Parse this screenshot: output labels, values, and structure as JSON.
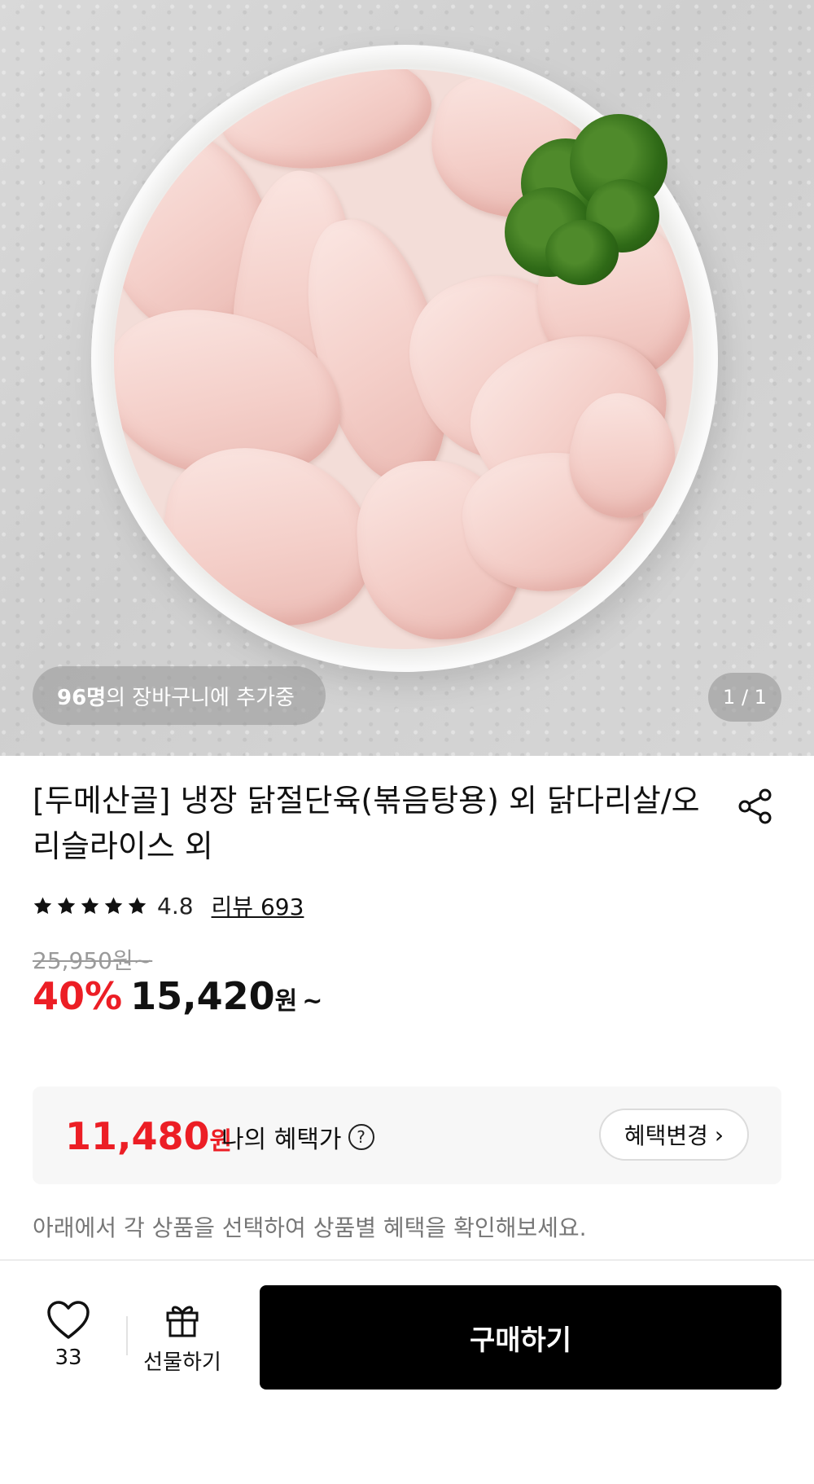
{
  "hero": {
    "basket_count": "96명",
    "basket_suffix": "의 장바구니에 추가중",
    "image_counter": "1 / 1"
  },
  "product": {
    "title": "[두메산골] 냉장 닭절단육(볶음탕용) 외 닭다리살/오리슬라이스 외",
    "share_icon": "share-icon",
    "rating": "4.8",
    "stars": 5,
    "review_label": "리뷰 693",
    "original_price": "25,950원~",
    "discount": "40%",
    "price": "15,420",
    "price_unit": "원",
    "price_tilde": "~"
  },
  "benefit": {
    "price": "11,480",
    "unit": "원",
    "label": "나의 혜택가",
    "help_icon": "?",
    "change_button": "혜택변경",
    "change_chevron": "›"
  },
  "helper_text": "아래에서 각 상품을 선택하여 상품별 혜택을 확인해보세요.",
  "bottom_bar": {
    "like_count": "33",
    "gift_label": "선물하기",
    "buy_label": "구매하기"
  },
  "colors": {
    "accent_red": "#ec1e25",
    "buy_button": "#000000"
  }
}
